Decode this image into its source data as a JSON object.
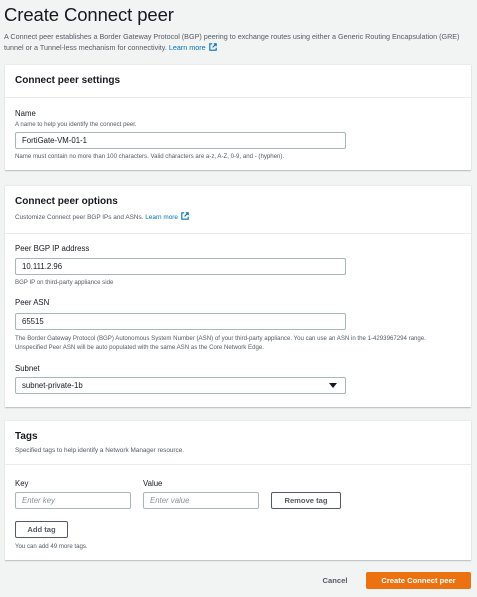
{
  "header": {
    "title": "Create Connect peer",
    "description": "A Connect peer establishes a Border Gateway Protocol (BGP) peering to exchange routes using either a Generic Routing Encapsulation (GRE) tunnel or a Tunnel-less mechanism for connectivity.",
    "learn_more": "Learn more"
  },
  "settings": {
    "title": "Connect peer settings",
    "name_label": "Name",
    "name_hint": "A name to help you identify the connect peer.",
    "name_value": "FortiGate-VM-01-1",
    "name_constraint": "Name must contain no more than 100 characters. Valid characters are a-z, A-Z, 0-9, and - (hyphen)."
  },
  "options": {
    "title": "Connect peer options",
    "subtitle": "Customize Connect peer BGP IPs and ASNs.",
    "learn_more": "Learn more",
    "bgp_ip_label": "Peer BGP IP address",
    "bgp_ip_value": "10.111.2.96",
    "bgp_ip_hint": "BGP IP on third-party appliance side",
    "asn_label": "Peer ASN",
    "asn_value": "65515",
    "asn_hint": "The Border Gateway Protocol (BGP) Autonomous System Number (ASN) of your third-party appliance. You can use an ASN in the 1-4293967294 range. Unspecified Peer ASN will be auto populated with the same ASN as the Core Network Edge.",
    "subnet_label": "Subnet",
    "subnet_value": "subnet-private-1b"
  },
  "tags": {
    "title": "Tags",
    "subtitle": "Specified tags to help identify a Network Manager resource.",
    "key_label": "Key",
    "value_label": "Value",
    "key_placeholder": "Enter key",
    "value_placeholder": "Enter value",
    "remove_tag": "Remove tag",
    "add_tag": "Add tag",
    "remaining": "You can add 49 more tags."
  },
  "footer": {
    "cancel": "Cancel",
    "submit": "Create Connect peer"
  },
  "colors": {
    "primary": "#ec7211",
    "link": "#0073bb",
    "background": "#f2f3f3"
  },
  "icons": {
    "external_link": "external-link-icon",
    "dropdown": "caret-down-icon"
  }
}
